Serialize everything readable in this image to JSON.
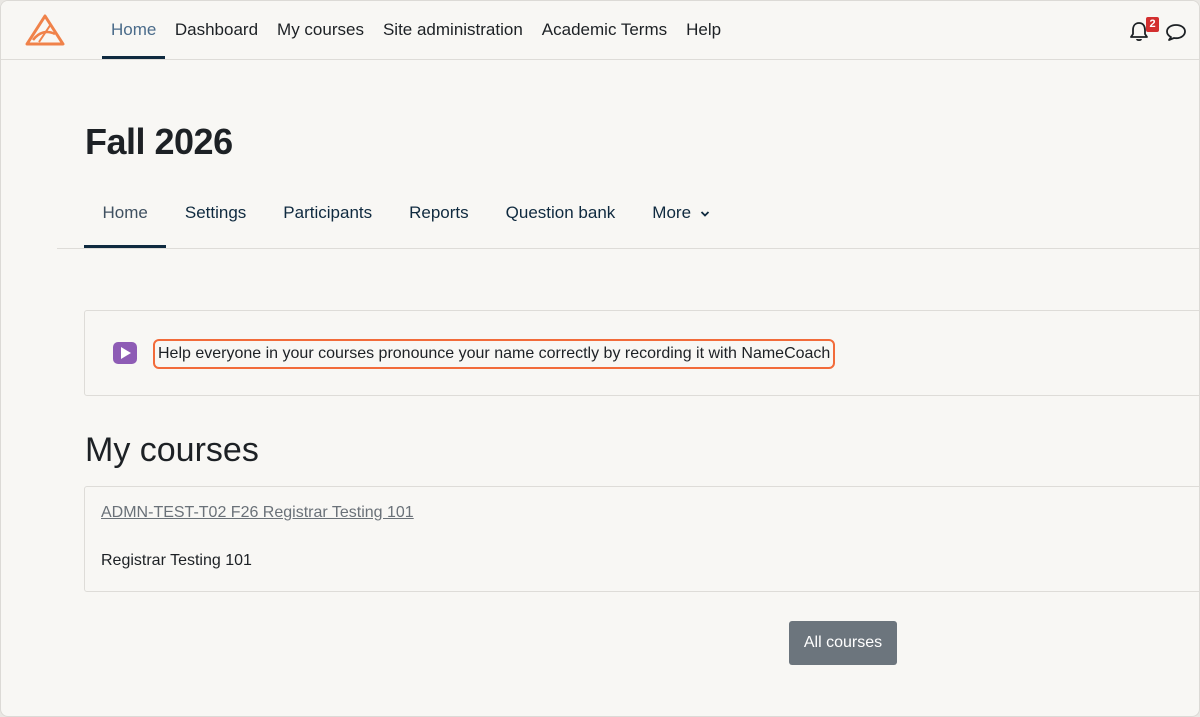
{
  "top_nav": {
    "items": [
      {
        "label": "Home",
        "active": true
      },
      {
        "label": "Dashboard"
      },
      {
        "label": "My courses"
      },
      {
        "label": "Site administration"
      },
      {
        "label": "Academic Terms"
      },
      {
        "label": "Help"
      }
    ],
    "notification_count": "2",
    "icons": [
      "logo-icon",
      "bell-icon",
      "chat-icon"
    ]
  },
  "course": {
    "title": "Fall 2026",
    "tabs": [
      {
        "label": "Home",
        "active": true
      },
      {
        "label": "Settings"
      },
      {
        "label": "Participants"
      },
      {
        "label": "Reports"
      },
      {
        "label": "Question bank"
      },
      {
        "label": "More"
      }
    ]
  },
  "notice": {
    "text": "Help everyone in your courses pronounce your name correctly by recording it with NameCoach",
    "icon": "play-icon",
    "icon_color": "#8e5cb5",
    "highlight_color": "#f26b3a"
  },
  "my_courses": {
    "heading": "My courses",
    "courses": [
      {
        "link": "ADMN-TEST-T02 F26 Registrar Testing 101",
        "name": "Registrar Testing 101"
      }
    ],
    "all_courses_label": "All courses"
  }
}
